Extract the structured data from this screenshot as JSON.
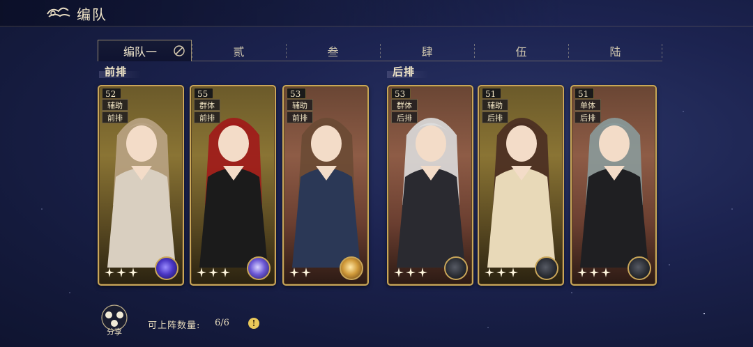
{
  "header": {
    "title": "编队",
    "back_icon": "cloud-back-icon"
  },
  "tabs": [
    {
      "label": "编队一",
      "active": true
    },
    {
      "label": "贰",
      "active": false
    },
    {
      "label": "叁",
      "active": false
    },
    {
      "label": "肆",
      "active": false
    },
    {
      "label": "伍",
      "active": false
    },
    {
      "label": "陆",
      "active": false
    }
  ],
  "rows": {
    "front": "前排",
    "back": "后排"
  },
  "cards": [
    {
      "level": "52",
      "tags": [
        "辅助",
        "前排"
      ],
      "frame": "gold",
      "emblem": "purple",
      "stars": 3
    },
    {
      "level": "55",
      "tags": [
        "群体",
        "前排"
      ],
      "frame": "gold",
      "emblem": "purple2",
      "stars": 3
    },
    {
      "level": "53",
      "tags": [
        "辅助",
        "前排"
      ],
      "frame": "copper",
      "emblem": "gold",
      "stars": 2
    },
    {
      "level": "53",
      "tags": [
        "群体",
        "后排"
      ],
      "frame": "copper",
      "emblem": "dark",
      "stars": 3
    },
    {
      "level": "51",
      "tags": [
        "辅助",
        "后排"
      ],
      "frame": "gold",
      "emblem": "dark",
      "stars": 3
    },
    {
      "level": "51",
      "tags": [
        "单体",
        "后排"
      ],
      "frame": "copper",
      "emblem": "dark",
      "stars": 3
    }
  ],
  "footer": {
    "share_label": "分享",
    "count_label": "可上阵数量:",
    "count_value": "6/6",
    "help_glyph": "!"
  }
}
